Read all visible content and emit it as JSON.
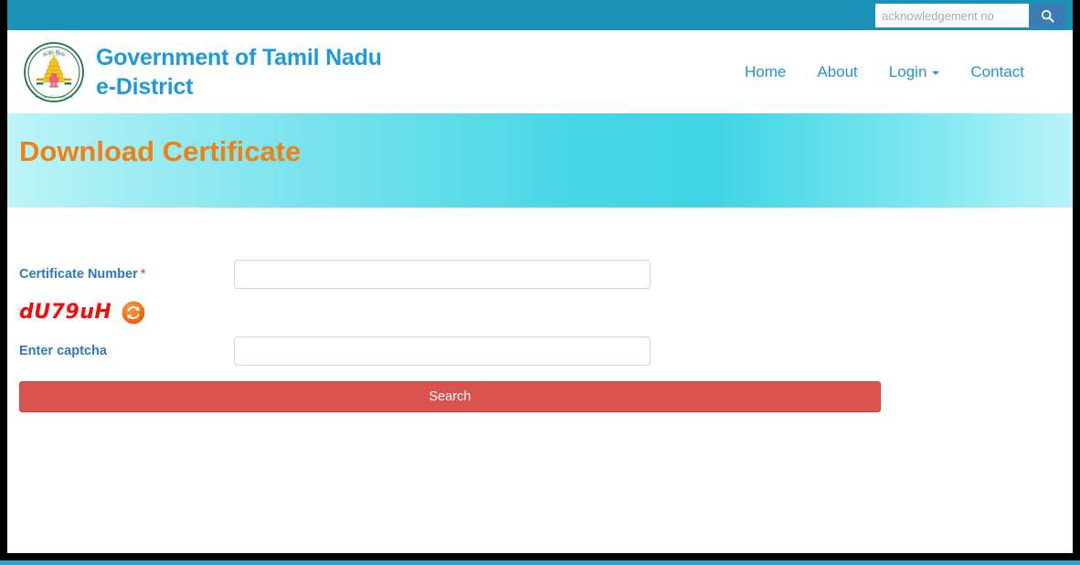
{
  "topbar": {
    "search": {
      "placeholder": "acknowledgement no",
      "value": "",
      "button_icon": "search-icon"
    }
  },
  "header": {
    "emblem_icon": "tamil-nadu-state-emblem",
    "brand_line1": "Government of Tamil Nadu",
    "brand_line2": "e-District",
    "nav": [
      {
        "label": "Home",
        "has_caret": false
      },
      {
        "label": "About",
        "has_caret": false
      },
      {
        "label": "Login",
        "has_caret": true
      },
      {
        "label": "Contact",
        "has_caret": false
      }
    ]
  },
  "banner": {
    "title": "Download Certificate"
  },
  "form": {
    "certificate_number": {
      "label": "Certificate Number",
      "required_mark": "*",
      "value": "",
      "placeholder": ""
    },
    "captcha": {
      "code": "dU79uH",
      "refresh_icon": "refresh-icon",
      "label": "Enter captcha",
      "value": "",
      "placeholder": ""
    },
    "submit_label": "Search"
  },
  "colors": {
    "topbar": "#1b91b8",
    "brand": "#1b9ae0",
    "nav_link": "#2196d4",
    "banner_title": "#ef8012",
    "banner_gradient_start": "#bdf4f8",
    "banner_gradient_mid": "#3fd4e4",
    "banner_gradient_end": "#b8f3f8",
    "label": "#2e7ab8",
    "required": "#e8342a",
    "captcha_text": "#f40b0b",
    "refresh_icon": "#f26b14",
    "submit_button": "#d9534f",
    "search_button": "#3c7cb4",
    "bottom_strip": "#27a4c9",
    "page_border": "#000000"
  }
}
